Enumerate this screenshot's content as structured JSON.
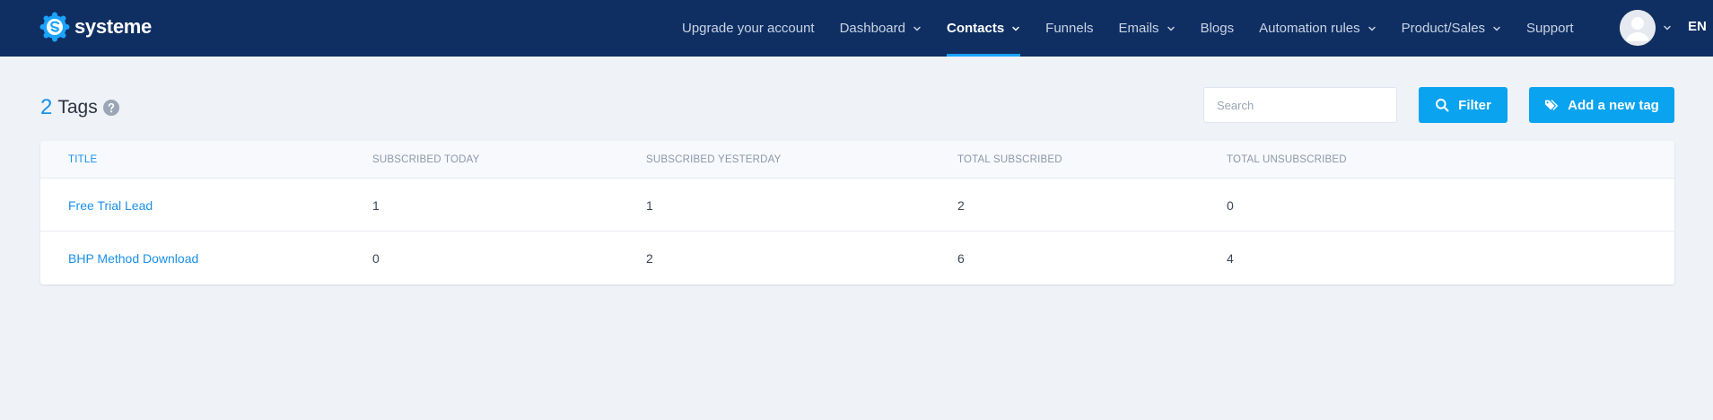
{
  "brand": {
    "name": "systeme",
    "accent": "#0aa3f0",
    "navbar": "#0f2f63"
  },
  "nav": {
    "items": [
      {
        "label": "Upgrade your account",
        "dropdown": false,
        "active": false
      },
      {
        "label": "Dashboard",
        "dropdown": true,
        "active": false
      },
      {
        "label": "Contacts",
        "dropdown": true,
        "active": true
      },
      {
        "label": "Funnels",
        "dropdown": false,
        "active": false
      },
      {
        "label": "Emails",
        "dropdown": true,
        "active": false
      },
      {
        "label": "Blogs",
        "dropdown": false,
        "active": false
      },
      {
        "label": "Automation rules",
        "dropdown": true,
        "active": false
      },
      {
        "label": "Product/Sales",
        "dropdown": true,
        "active": false
      },
      {
        "label": "Support",
        "dropdown": false,
        "active": false
      }
    ],
    "language": "EN"
  },
  "header": {
    "count": "2",
    "title": "Tags",
    "search_placeholder": "Search",
    "filter_label": "Filter",
    "add_label": "Add a new tag"
  },
  "table": {
    "columns": [
      "TITLE",
      "SUBSCRIBED TODAY",
      "SUBSCRIBED YESTERDAY",
      "TOTAL SUBSCRIBED",
      "TOTAL UNSUBSCRIBED"
    ],
    "rows": [
      [
        "Free Trial Lead",
        "1",
        "1",
        "2",
        "0"
      ],
      [
        "BHP Method Download",
        "0",
        "2",
        "6",
        "4"
      ]
    ]
  }
}
